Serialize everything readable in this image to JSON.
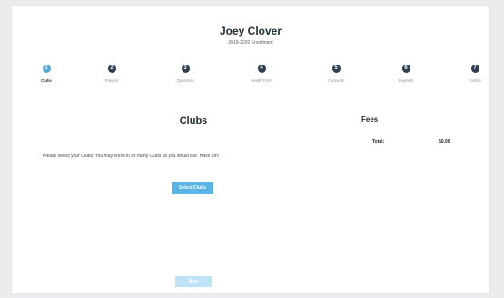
{
  "header": {
    "student_name": "Joey Clover",
    "subtitle": "2019-2020 Enrollment"
  },
  "steps": [
    {
      "number": "1",
      "label": "Clubs",
      "active": true
    },
    {
      "number": "2",
      "label": "Prayers",
      "active": false
    },
    {
      "number": "3",
      "label": "Questions",
      "active": false
    },
    {
      "number": "4",
      "label": "Health Form",
      "active": false
    },
    {
      "number": "5",
      "label": "Consents",
      "active": false
    },
    {
      "number": "6",
      "label": "Payment",
      "active": false
    },
    {
      "number": "7",
      "label": "Confirm",
      "active": false
    }
  ],
  "clubs": {
    "title": "Clubs",
    "instructions": "Please select your Clubs. You may enroll in as many Clubs as you would like. Have fun!",
    "select_button": "Select Clubs"
  },
  "fees": {
    "title": "Fees",
    "total_label": "Total:",
    "total_value": "$0.00"
  },
  "footer": {
    "next_button": "Next"
  },
  "colors": {
    "active_step": "#58a8d8",
    "inactive_step": "#2c3e50",
    "primary_button": "#5ab4e6",
    "disabled_button": "#bfe3f6"
  }
}
